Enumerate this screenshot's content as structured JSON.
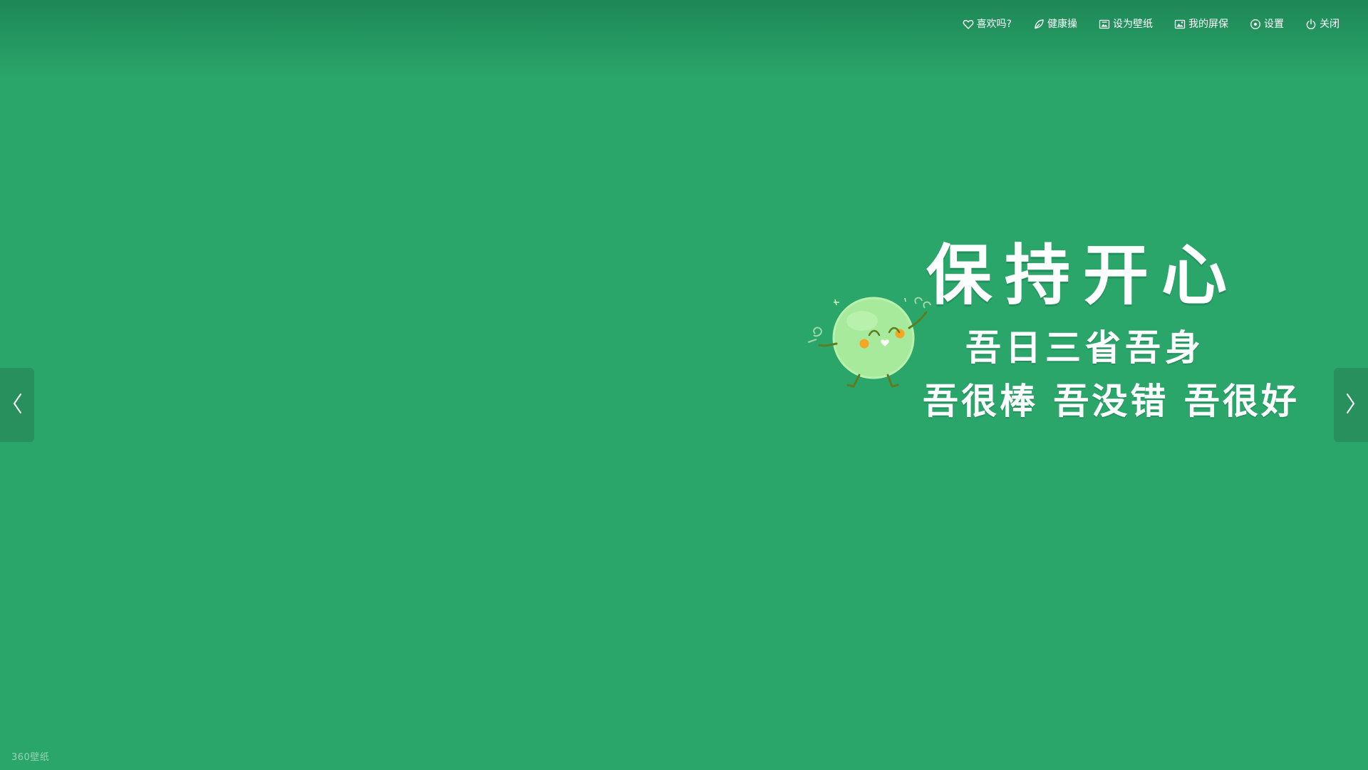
{
  "toolbar": {
    "items": [
      {
        "label": "喜欢吗?",
        "icon": "heart-icon"
      },
      {
        "label": "健康操",
        "icon": "leaf-icon"
      },
      {
        "label": "设为壁纸",
        "icon": "wallpaper-icon"
      },
      {
        "label": "我的屏保",
        "icon": "image-icon"
      },
      {
        "label": "设置",
        "icon": "settings-icon"
      },
      {
        "label": "关闭",
        "icon": "power-icon"
      }
    ]
  },
  "wallpaper": {
    "background_color": "#2aa66a",
    "headline": "保持开心",
    "line1": "吾日三省吾身",
    "line2": "吾很棒 吾没错 吾很好",
    "mascot": "smiling-green-ball-icon"
  },
  "navigation": {
    "prev": "chevron-left-icon",
    "next": "chevron-right-icon"
  },
  "watermark": "360壁纸"
}
